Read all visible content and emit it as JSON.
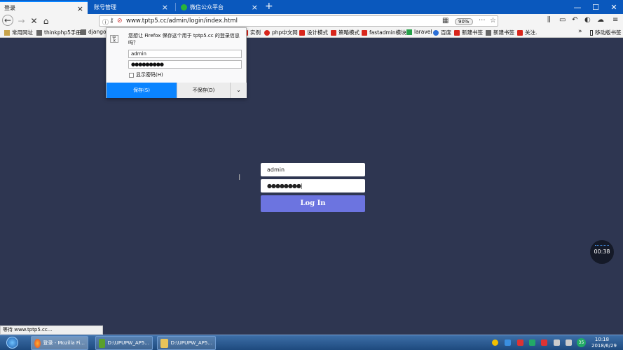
{
  "tabs": [
    {
      "label": "登录"
    },
    {
      "label": "账号管理"
    },
    {
      "label": "微信公众平台"
    }
  ],
  "new_tab_symbol": "+",
  "window_controls": {
    "minimize": "—",
    "maximize": "☐",
    "close": "✕"
  },
  "nav": {
    "url": "www.tptp5.cc/admin/login/index.html",
    "zoom": "90%",
    "more": "···"
  },
  "bookmarks": [
    {
      "label": "常用网址",
      "icon": "folder-icon"
    },
    {
      "label": "thinkphp5手册",
      "icon": "gear-icon"
    },
    {
      "label": "django",
      "icon": "dj-icon"
    },
    {
      "label": "实例",
      "icon": "red-icon"
    },
    {
      "label": "php中文网",
      "icon": "red-icon"
    },
    {
      "label": "设计模式",
      "icon": "red-icon"
    },
    {
      "label": "策略模式",
      "icon": "red-icon"
    },
    {
      "label": "fastadmin模块",
      "icon": "red-icon"
    },
    {
      "label": "laravel",
      "icon": "green-icon"
    },
    {
      "label": "百度",
      "icon": "blue-icon"
    },
    {
      "label": "新建书签",
      "icon": "red-icon"
    },
    {
      "label": "新建书签",
      "icon": "gray-icon"
    },
    {
      "label": "关注.",
      "icon": "red-icon"
    }
  ],
  "bookmarks_overflow": "»",
  "mobile_bookmarks": "移动版书签",
  "password_popup": {
    "question": "您想让 Firefox 保存这个用于 tptp5.cc 的登录信息吗？",
    "username": "admin",
    "password": "●●●●●●●●●",
    "show_password": "显示密码(H)",
    "save": "保存(S)",
    "dont_save": "不保存(D)",
    "more": "⌄"
  },
  "login_form": {
    "username": "admin",
    "password": "●●●●●●●●",
    "submit": "Log In"
  },
  "timer": "00:38",
  "status_text": "等待 www.tptp5.cc...",
  "taskbar": {
    "items": [
      {
        "label": "登录 - Mozilla Fi..."
      },
      {
        "label": "D:\\UPUPW_AP5..."
      },
      {
        "label": "D:\\UPUPW_AP5..."
      }
    ],
    "tray_badge": "35",
    "time": "10:18",
    "date": "2018/6/29"
  },
  "colors": {
    "tabstrip": "#0a58bd",
    "page_bg": "#2e3651",
    "login_button": "#6c74e0",
    "save_button": "#0a84ff"
  }
}
